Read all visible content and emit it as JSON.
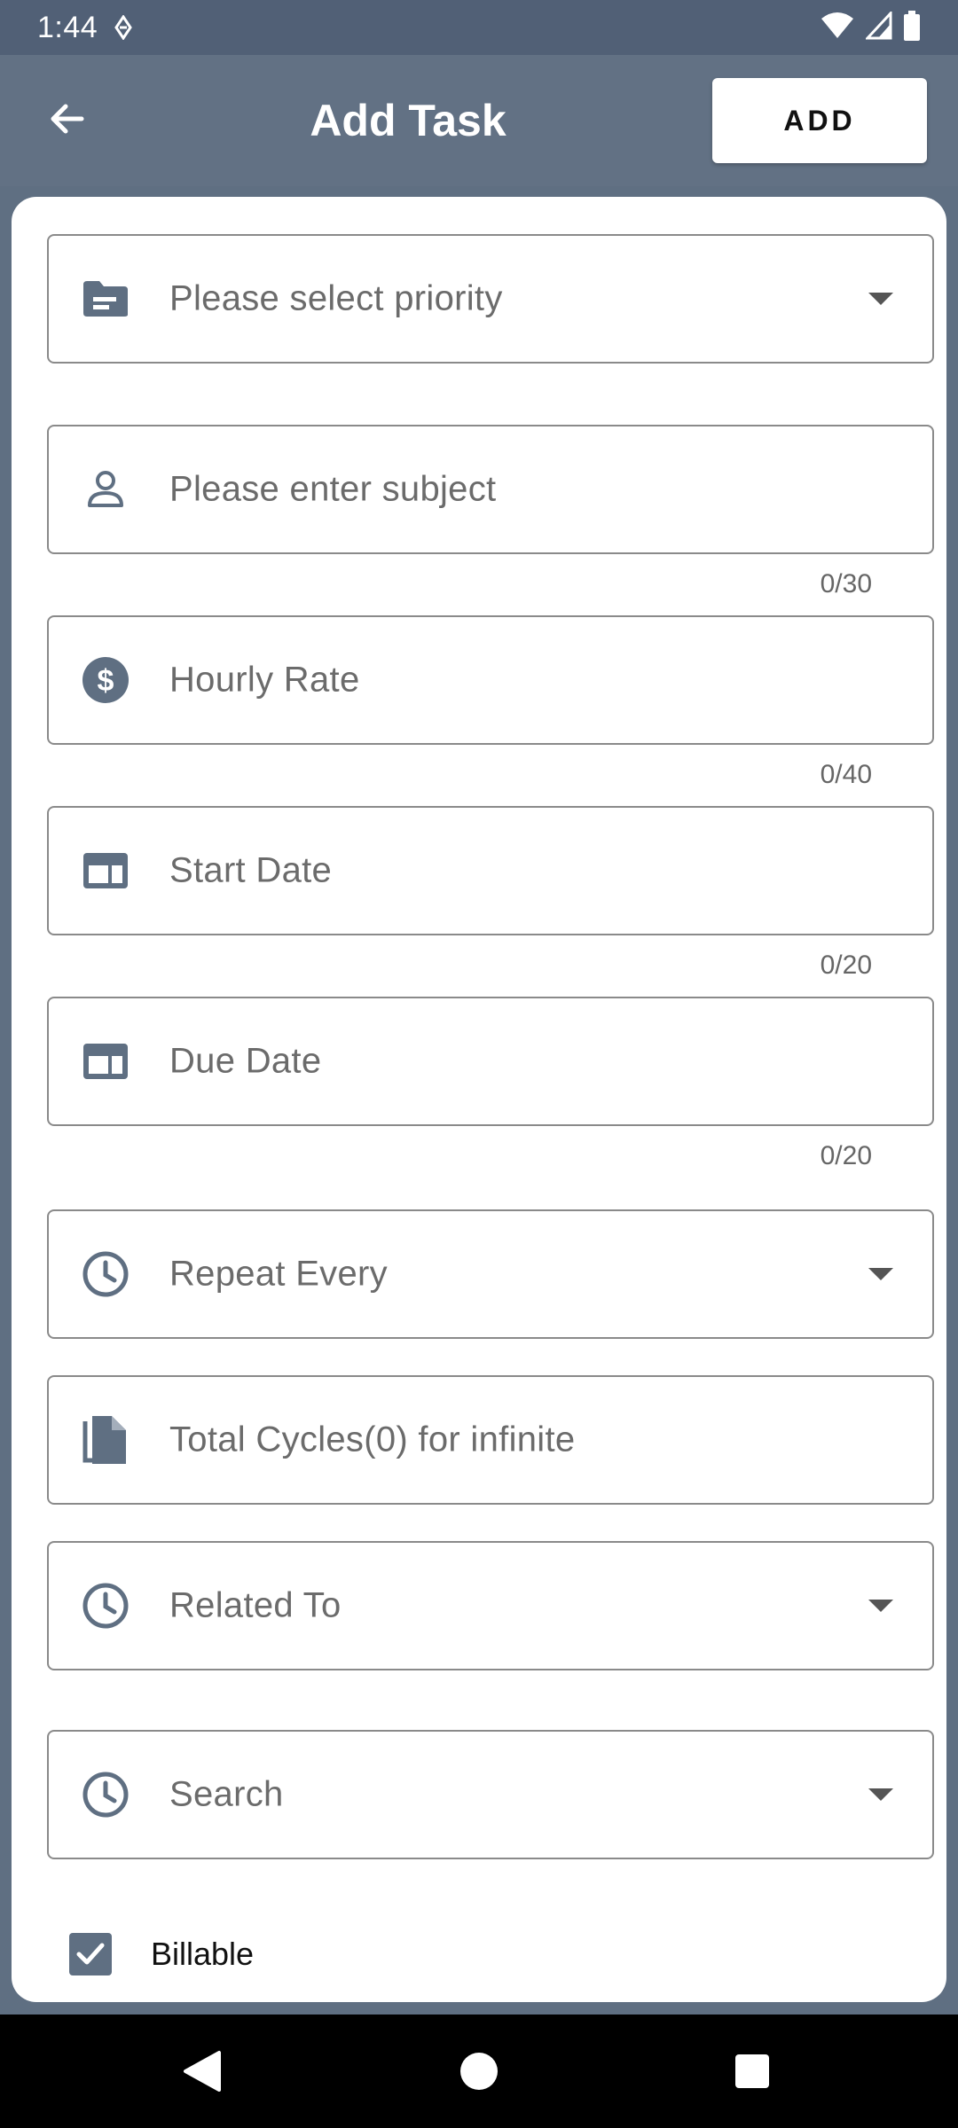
{
  "status_bar": {
    "time": "1:44",
    "icons": [
      "data-saver-icon",
      "wifi-icon",
      "signal-icon",
      "battery-icon"
    ]
  },
  "app_bar": {
    "title": "Add Task",
    "add_label": "ADD",
    "back_icon": "arrow-left-icon"
  },
  "form": {
    "priority": {
      "placeholder": "Please select priority",
      "icon": "folder-icon"
    },
    "subject": {
      "placeholder": "Please enter subject",
      "icon": "person-icon",
      "counter": "0/30"
    },
    "hourly_rate": {
      "placeholder": "Hourly Rate",
      "icon": "dollar-circle-icon",
      "counter": "0/40"
    },
    "start_date": {
      "placeholder": "Start Date",
      "icon": "calendar-card-icon",
      "counter": "0/20"
    },
    "due_date": {
      "placeholder": "Due Date",
      "icon": "calendar-card-icon",
      "counter": "0/20"
    },
    "repeat_every": {
      "placeholder": "Repeat Every",
      "icon": "clock-icon"
    },
    "total_cycles": {
      "placeholder": "Total Cycles(0) for infinite",
      "icon": "file-copy-icon"
    },
    "related_to": {
      "placeholder": "Related To",
      "icon": "clock-icon"
    },
    "search": {
      "placeholder": "Search",
      "icon": "clock-icon"
    },
    "billable": {
      "label": "Billable",
      "checked": true
    }
  },
  "colors": {
    "app_bar": "#627184",
    "status_bar": "#516076",
    "icon": "#5f6f82",
    "border": "#8a8a8a"
  }
}
